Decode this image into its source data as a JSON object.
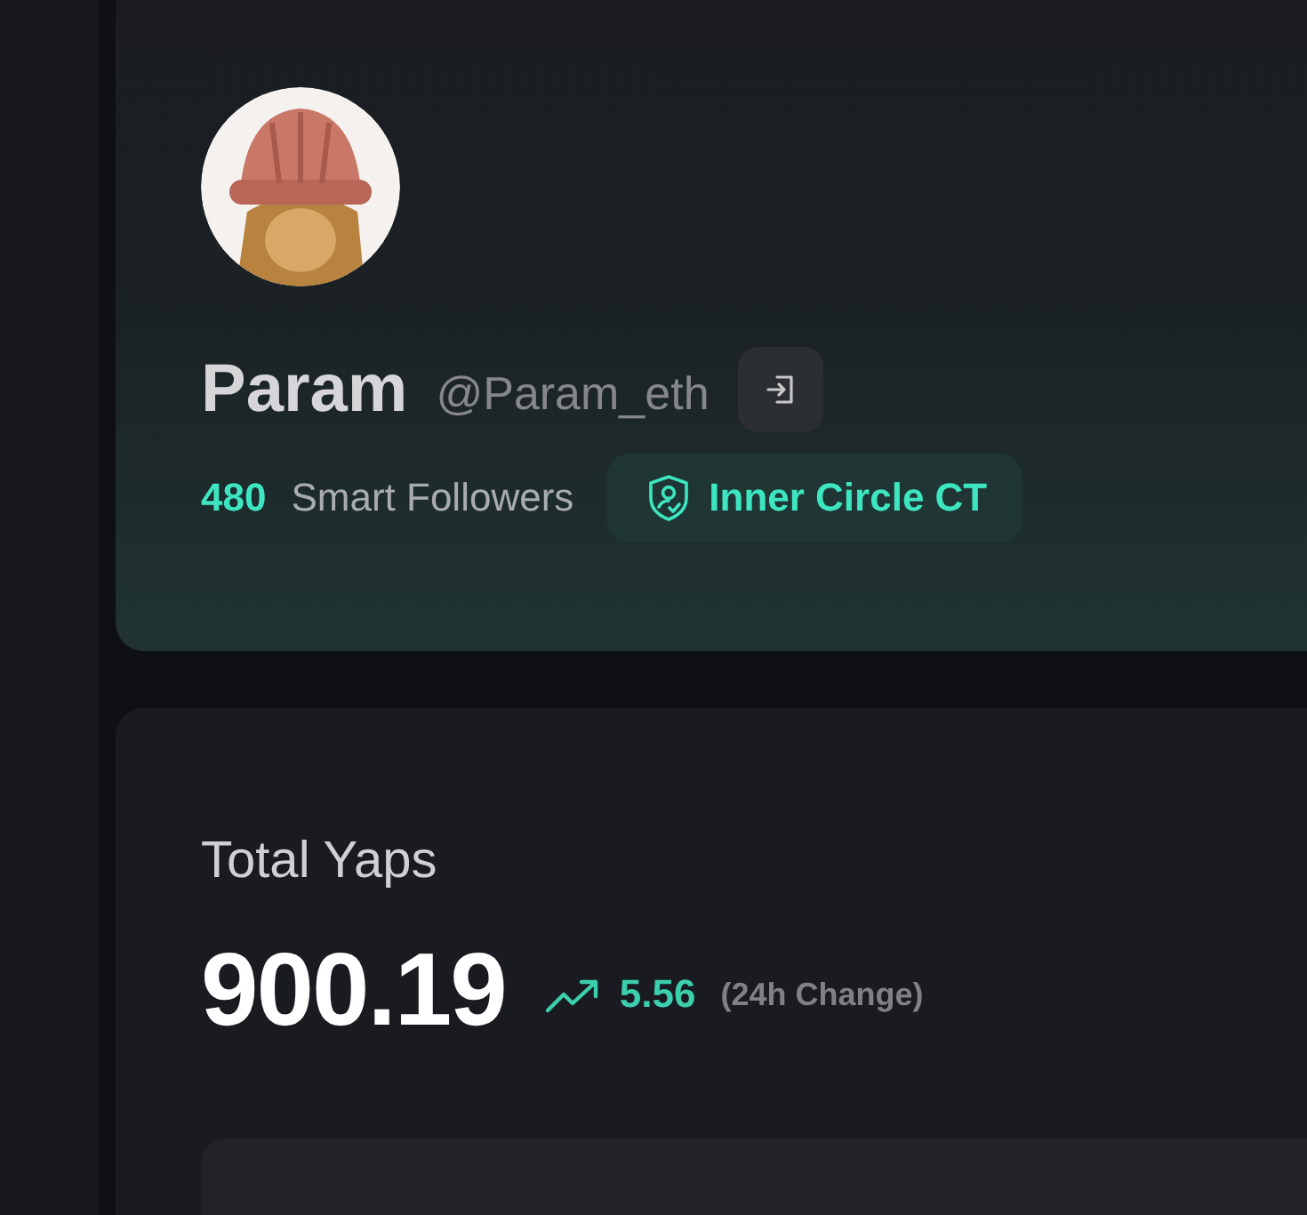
{
  "profile": {
    "name": "Param",
    "handle": "@Param_eth",
    "smart_followers_count": "480",
    "smart_followers_label": "Smart Followers",
    "badge": "Inner Circle CT"
  },
  "stats": {
    "title": "Total Yaps",
    "value": "900.19",
    "change": "5.56",
    "change_label": "(24h Change)"
  }
}
